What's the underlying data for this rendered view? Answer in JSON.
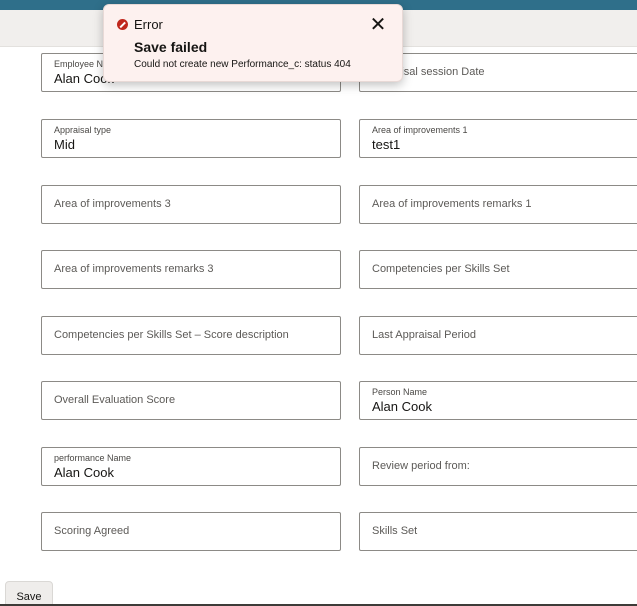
{
  "form": {
    "employee_name": {
      "label": "Employee Name",
      "value": "Alan Cook"
    },
    "appraisal_session_date": {
      "placeholder": "Appraisal session Date"
    },
    "appraisal_type": {
      "label": "Appraisal type",
      "value": "Mid"
    },
    "area_of_improvements_1": {
      "label": "Area of improvements 1",
      "value": "test1"
    },
    "area_of_improvements_3": {
      "placeholder": "Area of improvements 3"
    },
    "area_of_improvements_remarks_1": {
      "placeholder": "Area of improvements remarks 1"
    },
    "area_of_improvements_remarks_3": {
      "placeholder": "Area of improvements remarks 3"
    },
    "competencies_per_skills_set": {
      "placeholder": "Competencies per Skills Set"
    },
    "competencies_score_description": {
      "placeholder": "Competencies per Skills Set – Score description"
    },
    "last_appraisal_period": {
      "placeholder": "Last Appraisal Period"
    },
    "overall_evaluation_score": {
      "placeholder": "Overall Evaluation Score"
    },
    "person_name": {
      "label": "Person Name",
      "value": "Alan Cook"
    },
    "performance_name": {
      "label": "performance Name",
      "value": "Alan Cook"
    },
    "review_period_from": {
      "placeholder": "Review period from:"
    },
    "scoring_agreed": {
      "placeholder": "Scoring Agreed"
    },
    "skills_set": {
      "placeholder": "Skills Set"
    }
  },
  "footer": {
    "save_label": "Save"
  },
  "toast": {
    "type_label": "Error",
    "headline": "Save failed",
    "detail": "Could not create new Performance_c: status 404",
    "close_glyph": "✕"
  },
  "colors": {
    "header_accent": "#2f6f8a",
    "error_red": "#c0271d",
    "toast_bg": "#fdf1ef"
  }
}
